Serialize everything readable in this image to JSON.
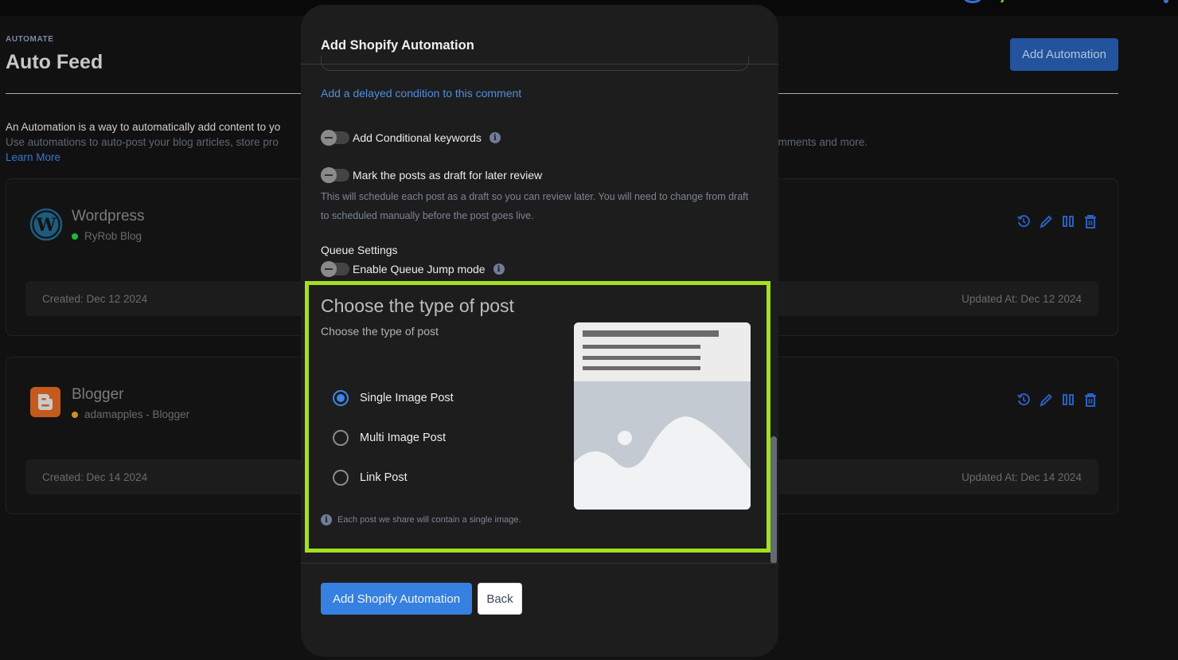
{
  "page": {
    "eyebrow": "AUTOMATE",
    "title": "Auto Feed",
    "add_button": "Add Automation",
    "intro_line1": "An Automation is a way to automatically add content to yo",
    "intro_line2_left": "Use automations to auto-post your blog articles, store pro",
    "intro_line2_right": "omments and more.",
    "learn_more": "Learn More"
  },
  "automations": [
    {
      "name": "Wordpress",
      "account": "RyRob Blog",
      "status_color": "#1db936",
      "created": "Created: Dec 12 2024",
      "updated": "Updated At: Dec 12 2024",
      "icon": "wordpress-icon"
    },
    {
      "name": "Blogger",
      "account": "adamapples - Blogger",
      "status_color": "#c9902a",
      "created": "Created: Dec 14 2024",
      "updated": "Updated At: Dec 14 2024",
      "icon": "blogger-icon"
    }
  ],
  "modal": {
    "title": "Add Shopify Automation",
    "delayed_link": "Add a delayed condition to this comment",
    "toggles": {
      "conditional_keywords": "Add Conditional keywords",
      "draft_review": "Mark the posts as draft for later review",
      "queue_jump": "Enable Queue Jump mode"
    },
    "draft_helper": "This will schedule each post as a draft so you can review later. You will need to change from draft to scheduled manually before the post goes live.",
    "queue_settings": "Queue Settings",
    "post_type": {
      "title": "Choose the type of post",
      "subtitle": "Choose the type of post",
      "options": [
        "Single Image Post",
        "Multi Image Post",
        "Link Post"
      ],
      "selected": "Single Image Post",
      "note": "Each post we share will contain a single image."
    },
    "submit": "Add Shopify Automation",
    "back": "Back"
  },
  "colors": {
    "accent": "#3580e0",
    "highlight": "#a4e01d"
  }
}
